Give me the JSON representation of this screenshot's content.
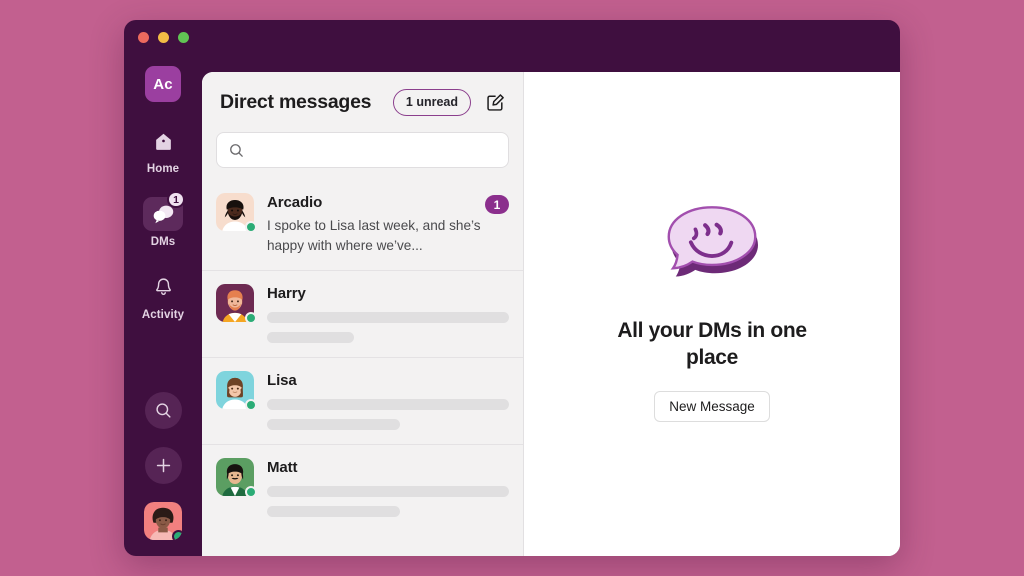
{
  "theme": {
    "page_background": "#c2608f",
    "window_frame": "#3f0f3f",
    "accent_purple": "#8b2f8d",
    "list_background": "#f3f2f2",
    "presence_online": "#2bac76"
  },
  "window": {
    "traffic_lights": [
      {
        "name": "close",
        "color": "#ec6a5e"
      },
      {
        "name": "minimize",
        "color": "#f3bc45"
      },
      {
        "name": "maximize",
        "color": "#61c454"
      }
    ]
  },
  "rail": {
    "workspace_initials": "Ac",
    "items": [
      {
        "icon": "home-icon",
        "label": "Home",
        "active": false,
        "badge": null
      },
      {
        "icon": "dms-icon",
        "label": "DMs",
        "active": true,
        "badge": "1"
      },
      {
        "icon": "activity-bell-icon",
        "label": "Activity",
        "active": false,
        "badge": null
      }
    ],
    "search_icon": "search-icon",
    "new_icon": "plus-icon",
    "avatar": {
      "name": "current-user-avatar",
      "presence": "online"
    }
  },
  "dm_panel": {
    "title": "Direct messages",
    "unread_pill": "1 unread",
    "compose_icon": "compose-pencil-icon",
    "search": {
      "placeholder": "",
      "value": "",
      "icon": "search-icon"
    },
    "conversations": [
      {
        "name": "Arcadio",
        "preview": "I spoke to Lisa last week, and she’s happy with where we’ve...",
        "badge": "1",
        "presence": "online",
        "avatar_style": "arcadio",
        "skeleton": false
      },
      {
        "name": "Harry",
        "preview": "",
        "badge": null,
        "presence": "online",
        "avatar_style": "harry",
        "skeleton": true
      },
      {
        "name": "Lisa",
        "preview": "",
        "badge": null,
        "presence": "online",
        "avatar_style": "lisa",
        "skeleton": true
      },
      {
        "name": "Matt",
        "preview": "",
        "badge": null,
        "presence": "online",
        "avatar_style": "matt",
        "skeleton": true
      }
    ]
  },
  "empty_state": {
    "illustration": "smiley-speech-bubble-illustration",
    "title": "All your DMs in one place",
    "button_label": "New Message"
  }
}
